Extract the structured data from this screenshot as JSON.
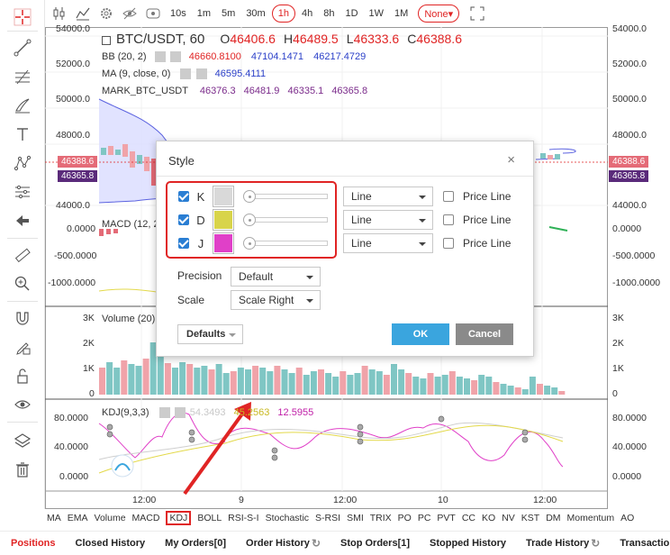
{
  "toolbar": {
    "intervals": [
      "10s",
      "1m",
      "5m",
      "30m",
      "1h",
      "4h",
      "8h",
      "1D",
      "1W",
      "1M"
    ],
    "active_interval": "1h",
    "none_label": "None▾"
  },
  "legend": {
    "symbol": "BTC/USDT, 60",
    "ohlc": [
      {
        "k": "O",
        "v": "46406.6"
      },
      {
        "k": "H",
        "v": "46489.5"
      },
      {
        "k": "L",
        "v": "46333.6"
      },
      {
        "k": "C",
        "v": "46388.6"
      }
    ],
    "bb_label": "BB (20, 2)",
    "bb_values": [
      "46660.8100",
      "47104.1471",
      "46217.4729"
    ],
    "ma_label": "MA (9, close, 0)",
    "ma_value": "46595.4111",
    "mark_label": "MARK_BTC_USDT",
    "mark_values": [
      "46376.3",
      "46481.9",
      "46335.1",
      "46365.8"
    ],
    "macd_label": "MACD (12, 2",
    "volume_label": "Volume (20)",
    "kdj_label": "KDJ(9,3,3)",
    "kdj_values": [
      "54.3493",
      "45.2563",
      "12.5955"
    ]
  },
  "price_labels": {
    "last": "46388.6",
    "mark": "46365.8"
  },
  "axes": {
    "price_ticks": [
      "54000.0",
      "52000.0",
      "50000.0",
      "48000.0",
      "44000.0"
    ],
    "left_price_ticks": [
      "54000.0",
      "52000.0",
      "50000.0",
      "48000.0"
    ],
    "left_price_tick_44000": "44000.0",
    "macd_ticks": [
      "0.0000",
      "-500.0000",
      "-1000.0000"
    ],
    "left_macd_ticks": [
      "0.0000",
      "-500.0000",
      "-1000.0000"
    ],
    "volume_ticks": [
      "3K",
      "2K",
      "1K",
      "0"
    ],
    "kdj_ticks": [
      "80.0000",
      "40.0000",
      "0.0000"
    ],
    "time_ticks": [
      "12:00",
      "9",
      "12:00",
      "10",
      "12:00"
    ]
  },
  "indicators": [
    "MA",
    "EMA",
    "Volume",
    "MACD",
    "KDJ",
    "BOLL",
    "RSI-S-I",
    "Stochastic",
    "S-RSI",
    "SMI",
    "TRIX",
    "PO",
    "PC",
    "PVT",
    "CC",
    "KO",
    "NV",
    "KST",
    "DM",
    "Momentum",
    "AO"
  ],
  "highlighted_indicator": "KDJ",
  "bottom_tabs": [
    "Positions",
    "Closed History",
    "My Orders[0]",
    "Order History",
    "Stop Orders[1]",
    "Stopped History",
    "Trade History",
    "Transactions"
  ],
  "active_tab": "Positions",
  "dialog": {
    "title": "Style",
    "close": "×",
    "rows": [
      {
        "label": "K",
        "color": "#d9d9d9",
        "style": "Line",
        "price_line": "Price Line"
      },
      {
        "label": "D",
        "color": "#d8d44a",
        "style": "Line",
        "price_line": "Price Line"
      },
      {
        "label": "J",
        "color": "#e040c8",
        "style": "Line",
        "price_line": "Price Line"
      }
    ],
    "precision_label": "Precision",
    "precision_value": "Default",
    "scale_label": "Scale",
    "scale_value": "Scale Right",
    "defaults_label": "Defaults",
    "ok_label": "OK",
    "cancel_label": "Cancel"
  },
  "colors": {
    "accent": "#e02424",
    "ok": "#3aa5de",
    "cancel": "#8a8a8a",
    "up_candle": "#7fc6c4",
    "down_candle": "#f0a3a9",
    "k_line": "#d9d9d9",
    "d_line": "#e3d94a",
    "j_line": "#e040c8"
  }
}
